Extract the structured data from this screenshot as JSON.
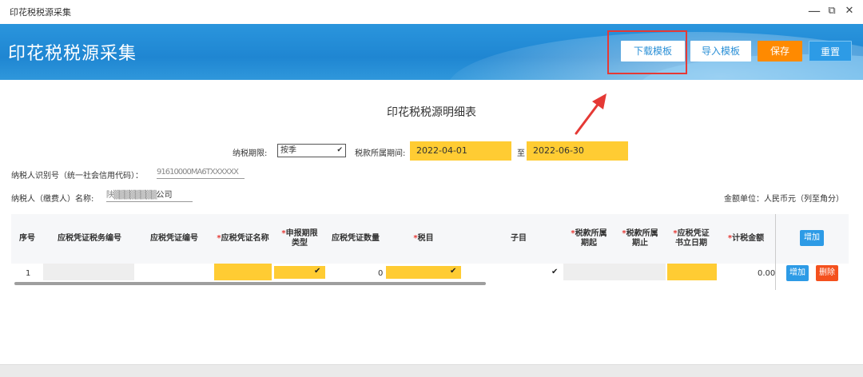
{
  "window": {
    "title": "印花税税源采集",
    "controls": [
      "—",
      "⧉",
      "✕"
    ]
  },
  "banner": {
    "heading": "印花税税源采集"
  },
  "toolbar": {
    "download_template": "下载模板",
    "import_template": "导入模板",
    "save": "保存",
    "reset": "重置"
  },
  "form": {
    "title": "印花税税源明细表",
    "tax_period_label": "纳税期限:",
    "tax_period_value": "按季",
    "period_label": "税款所属期间:",
    "period_start": "2022-04-01",
    "period_to": "至",
    "period_end": "2022-06-30",
    "taxpayer_id_label": "纳税人识别号（统一社会信用代码）：",
    "taxpayer_id_value": "91610000MA6TXXXXXX",
    "taxpayer_name_label": "纳税人（缴费人）名称:",
    "taxpayer_name_prefix": "陕▒▒▒▒▒▒▒▒",
    "taxpayer_name_suffix": "公司",
    "amount_unit": "金额单位：人民币元（列至角分）"
  },
  "table": {
    "columns": [
      {
        "label": "序号",
        "required": false
      },
      {
        "label": "应税凭证税务编号",
        "required": false
      },
      {
        "label": "应税凭证编号",
        "required": false
      },
      {
        "label": "应税凭证名称",
        "required": true
      },
      {
        "label": "申报期限类型",
        "required": true
      },
      {
        "label": "应税凭证数量",
        "required": false
      },
      {
        "label": "税目",
        "required": true
      },
      {
        "label": "子目",
        "required": false
      },
      {
        "label": "税款所属期起",
        "required": true
      },
      {
        "label": "税款所属期止",
        "required": true
      },
      {
        "label": "应税凭证书立日期",
        "required": true
      },
      {
        "label": "计税金额",
        "required": true
      }
    ],
    "header_add_button": "增加",
    "rows": [
      {
        "index": "1",
        "quantity": "0",
        "amount": "0.00",
        "add": "增加",
        "delete": "删除"
      }
    ]
  },
  "colors": {
    "banner": "#1f86d2",
    "accent_yellow": "#ffcc33",
    "save_orange": "#ff8a00",
    "delete_red": "#f4511e",
    "highlight_red": "#e53935"
  },
  "icons": [
    "minimize-icon",
    "restore-icon",
    "close-icon",
    "chevron-down-icon",
    "red-arrow-icon"
  ]
}
